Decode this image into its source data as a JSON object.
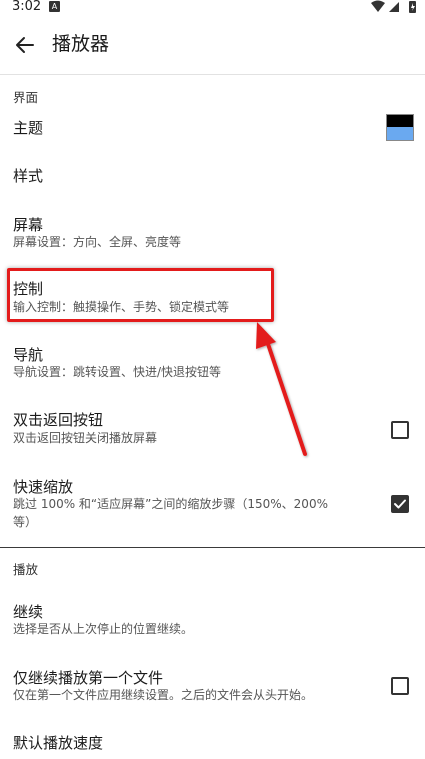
{
  "status_bar": {
    "time": "3:02",
    "indicator": "A"
  },
  "app_bar": {
    "title": "播放器",
    "back_icon": "arrow-back-icon"
  },
  "sections": [
    {
      "header": "界面"
    },
    {
      "header": "播放"
    }
  ],
  "rows": {
    "theme": {
      "title": "主题",
      "swatch_colors": [
        "#000000",
        "#6aa9f0"
      ]
    },
    "style": {
      "title": "样式"
    },
    "screen": {
      "title": "屏幕",
      "subtitle": "屏幕设置：方向、全屏、亮度等"
    },
    "control": {
      "title": "控制",
      "subtitle": "输入控制：触摸操作、手势、锁定模式等"
    },
    "nav": {
      "title": "导航",
      "subtitle": "导航设置：跳转设置、快进/快退按钮等"
    },
    "double_back": {
      "title": "双击返回按钮",
      "subtitle": "双击返回按钮关闭播放屏幕",
      "checked": false
    },
    "quick_zoom": {
      "title": "快速缩放",
      "subtitle_line1": "跳过 100% 和“适应屏幕”之间的缩放步骤（150%、200%",
      "subtitle_line2": "等）",
      "checked": true
    },
    "resume": {
      "title": "继续",
      "subtitle": "选择是否从上次停止的位置继续。"
    },
    "resume_first_only": {
      "title": "仅继续播放第一个文件",
      "subtitle": "仅在第一个文件应用继续设置。之后的文件会从头开始。",
      "checked": false
    },
    "default_speed": {
      "title": "默认播放速度"
    }
  },
  "annotation": {
    "color": "#e31b1b"
  }
}
